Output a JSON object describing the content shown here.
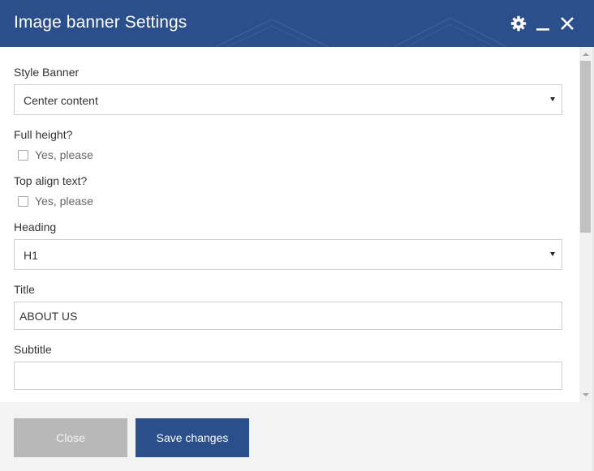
{
  "dialog": {
    "title": "Image banner Settings",
    "icons": {
      "settings": "gear-icon",
      "minimize": "minimize-icon",
      "close": "close-icon"
    }
  },
  "form": {
    "style_banner": {
      "label": "Style Banner",
      "value": "Center content"
    },
    "full_height": {
      "label": "Full height?",
      "option_label": "Yes, please",
      "checked": false
    },
    "top_align": {
      "label": "Top align text?",
      "option_label": "Yes, please",
      "checked": false
    },
    "heading": {
      "label": "Heading",
      "value": "H1"
    },
    "title": {
      "label": "Title",
      "value": "ABOUT US"
    },
    "subtitle": {
      "label": "Subtitle",
      "value": ""
    }
  },
  "footer": {
    "close_label": "Close",
    "save_label": "Save changes"
  },
  "colors": {
    "header_bg": "#2b4f8a",
    "primary_button": "#2b4f8a",
    "disabled_button": "#b8b8b8"
  }
}
